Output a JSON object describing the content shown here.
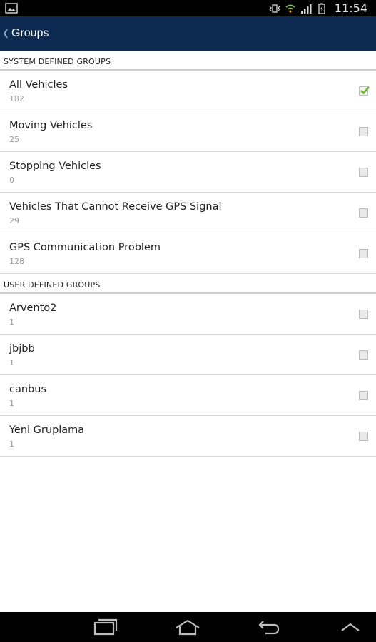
{
  "status_bar": {
    "time": "11:54",
    "icons": [
      "gallery-icon",
      "vibrate-icon",
      "wifi-icon",
      "signal-icon",
      "battery-icon"
    ]
  },
  "action_bar": {
    "title": "Groups",
    "background": "#0c2a52"
  },
  "sections": [
    {
      "header": "SYSTEM DEFINED GROUPS",
      "items": [
        {
          "name": "All Vehicles",
          "count": "182",
          "checked": true
        },
        {
          "name": "Moving Vehicles",
          "count": "25",
          "checked": false
        },
        {
          "name": "Stopping Vehicles",
          "count": "0",
          "checked": false
        },
        {
          "name": "Vehicles That Cannot Receive GPS Signal",
          "count": "29",
          "checked": false
        },
        {
          "name": "GPS Communication Problem",
          "count": "128",
          "checked": false
        }
      ]
    },
    {
      "header": "USER DEFINED GROUPS",
      "items": [
        {
          "name": "Arvento2",
          "count": "1",
          "checked": false
        },
        {
          "name": "jbjbb",
          "count": "1",
          "checked": false
        },
        {
          "name": "canbus",
          "count": "1",
          "checked": false
        },
        {
          "name": "Yeni Gruplama",
          "count": "1",
          "checked": false
        }
      ]
    }
  ],
  "nav_bar": {
    "buttons": [
      "recent-apps-icon",
      "home-icon",
      "back-icon",
      "menu-up-icon"
    ]
  },
  "colors": {
    "accent_check": "#6ab42d"
  }
}
